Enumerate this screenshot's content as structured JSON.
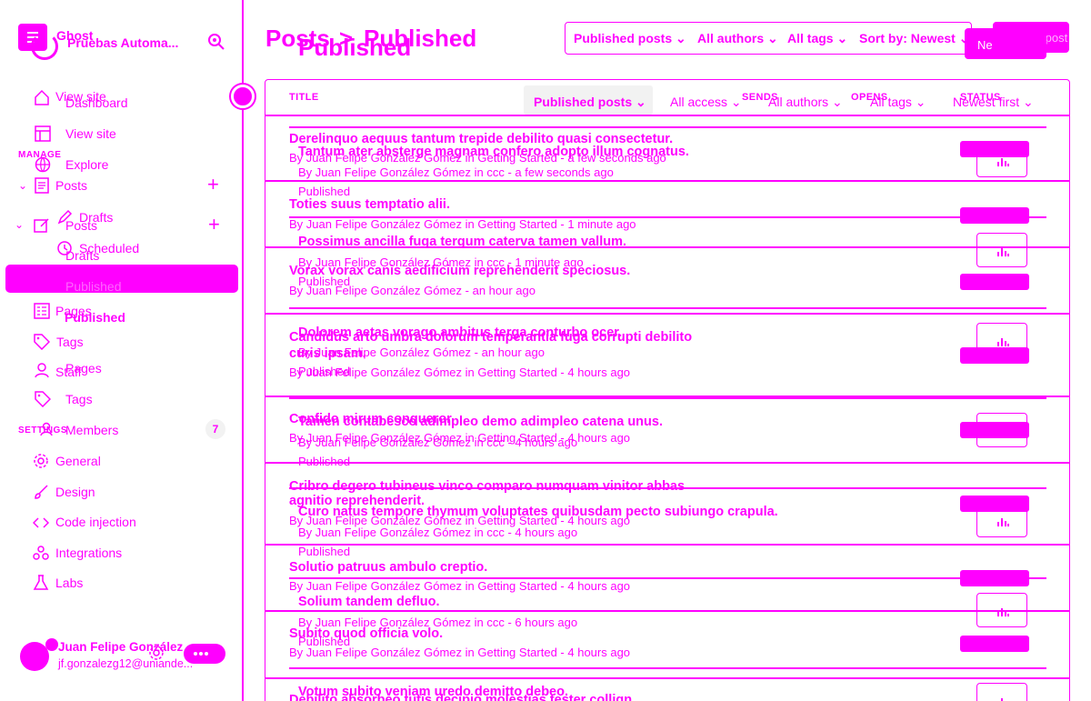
{
  "sidebar": {
    "site_name": "Ghost",
    "site_name_2": "Pruebas Automa...",
    "view_site_a": "View site",
    "dashboard": "Dashboard",
    "view_site_b": "View site",
    "manage_label": "MANAGE",
    "explore": "Explore",
    "posts_a": "Posts",
    "drafts_a": "Drafts",
    "posts_b": "Posts",
    "scheduled": "Scheduled",
    "drafts_b": "Drafts",
    "published_a": "Published",
    "pages_a": "Pages",
    "published_b": "Published",
    "tags_a": "Tags",
    "staff": "Staff",
    "pages_b": "Pages",
    "tags_b": "Tags",
    "settings_label": "SETTINGS",
    "members": "Members",
    "members_count": "7",
    "general": "General",
    "design": "Design",
    "code_injection": "Code injection",
    "integrations": "Integrations",
    "labs": "Labs",
    "user_name": "Juan Felipe González",
    "user_email": "jf.gonzalezg12@uniande..."
  },
  "header": {
    "title_a": "Posts",
    "separator": ">",
    "title_b": "Published",
    "title_c": "Published",
    "new_post_a": "New post",
    "new_post_b": "Ne",
    "filters_top": [
      "Published posts",
      "All authors",
      "All tags",
      "Sort by: Newest"
    ],
    "filters_table": [
      "Published posts",
      "All access",
      "All authors",
      "All tags",
      "Newest first"
    ]
  },
  "table": {
    "col_title": "TITLE",
    "col_sends": "SENDS",
    "col_opens": "OPENS",
    "col_status": "STATUS"
  },
  "posts_a": [
    {
      "title": "Derelinquo aequus tantum trepide debilito quasi consectetur.",
      "meta": "By Juan Felipe González Gómez in Getting Started - a few seconds ago"
    },
    {
      "title": "Toties suus temptatio alii.",
      "meta": "By Juan Felipe González Gómez in Getting Started - 1 minute ago"
    },
    {
      "title": "Vorax vorax canis aedificium reprehenderit speciosus.",
      "meta": "By Juan Felipe González Gómez - an hour ago"
    },
    {
      "title": "Candidus arto umbra dolorum temperantia fuga corrupti debilito",
      "title2": "curis ipsam.",
      "meta": "By Juan Felipe González Gómez in Getting Started - 4 hours ago"
    },
    {
      "title": "Confido mirum conqueror.",
      "meta": "By Juan Felipe González Gómez in Getting Started - 4 hours ago"
    },
    {
      "title": "Cribro degero tubineus vinco comparo numquam vinitor abbas",
      "title2": "agnitio reprehenderit.",
      "meta": "By Juan Felipe González Gómez in Getting Started - 4 hours ago"
    },
    {
      "title": "Solutio patruus ambulo creptio.",
      "meta": "By Juan Felipe González Gómez in Getting Started - 4 hours ago"
    },
    {
      "title": "Subito quod officia volo.",
      "meta": "By Juan Felipe González Gómez in Getting Started - 4 hours ago"
    },
    {
      "title": "Debilito absorbeo tutis decipio molestias tester collign"
    }
  ],
  "posts_b": [
    {
      "title": "Tantum ater absterge magnam confero adopto illum cognatus.",
      "meta": "By Juan Felipe González Gómez in ccc - a few seconds ago",
      "status": "Published"
    },
    {
      "title": "Possimus ancilla fuga tergum caterva tamen vallum.",
      "meta": "By Juan Felipe González Gómez in ccc - 1 minute ago",
      "status": "Published"
    },
    {
      "title": "Dolorem aetas vorago ambitus terga conturbo ocer.",
      "meta": "By Juan Felipe González Gómez - an hour ago",
      "status": "Published"
    },
    {
      "title": "Tamen contabesco adimpleo demo adimpleo catena unus.",
      "meta": "By Juan Felipe González Gómez in ccc - 4 hours ago",
      "status": "Published"
    },
    {
      "title": "Curo natus tempore thymum voluptates quibusdam pecto subiungo crapula.",
      "meta": "By Juan Felipe González Gómez in ccc - 4 hours ago",
      "status": "Published"
    },
    {
      "title": "Solium tandem defluo.",
      "meta": "By Juan Felipe González Gómez in ccc - 6 hours ago",
      "status": "Published"
    },
    {
      "title": "Votum subito veniam uredo demitto debeo."
    }
  ],
  "colors": {
    "accent": "#ff00ff",
    "badge_bg": "#f2f2f2"
  },
  "icons": [
    "menu-icon",
    "search-icon",
    "home-icon",
    "layout-icon",
    "globe-icon",
    "posts-icon",
    "edit-icon",
    "pencil-icon",
    "clock-icon",
    "pages-icon",
    "tag-icon",
    "staff-icon",
    "members-icon",
    "gear-icon",
    "brush-icon",
    "code-icon",
    "integrations-icon",
    "flask-icon",
    "analytics-icon"
  ]
}
